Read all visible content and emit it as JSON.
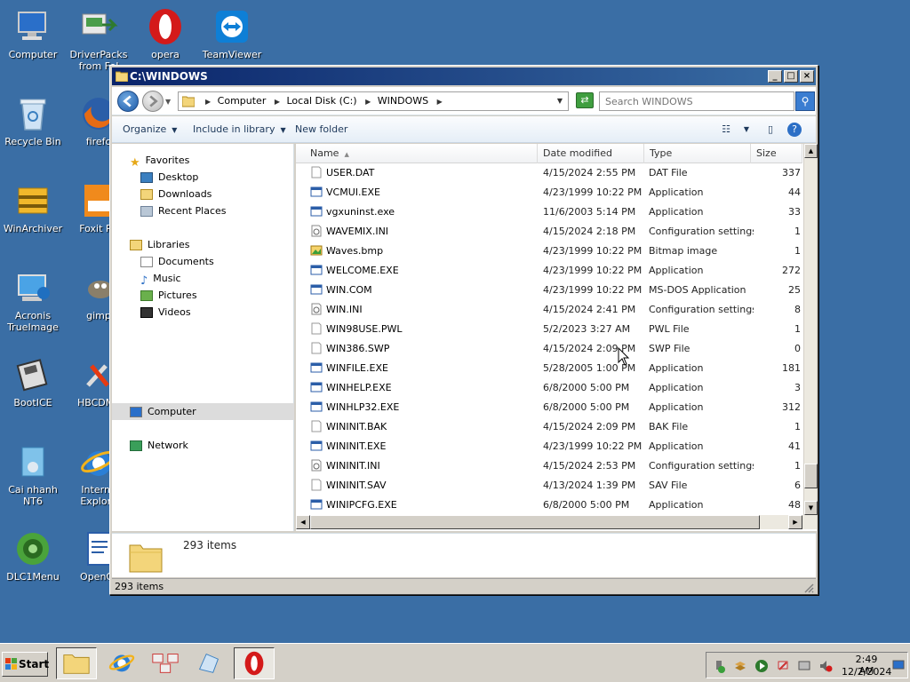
{
  "desktop": {
    "icons": [
      {
        "label": "Computer"
      },
      {
        "label": "DriverPacks from Fol"
      },
      {
        "label": "opera"
      },
      {
        "label": "TeamViewer"
      },
      {
        "label": "Recycle Bin"
      },
      {
        "label": "firefo"
      },
      {
        "label": "WinArchiver"
      },
      {
        "label": "Foxit Re"
      },
      {
        "label": "Acronis TrueImage"
      },
      {
        "label": "gimp"
      },
      {
        "label": "BootICE"
      },
      {
        "label": "HBCDMe"
      },
      {
        "label": "Cai nhanh NT6"
      },
      {
        "label": "Interne Explore"
      },
      {
        "label": "DLC1Menu"
      },
      {
        "label": "OpenOf"
      }
    ]
  },
  "window": {
    "title": "C:\\WINDOWS",
    "buttons": {
      "minimize": "_",
      "maximize": "□",
      "close": "×"
    },
    "address": {
      "crumbs": [
        "Computer",
        "Local Disk (C:)",
        "WINDOWS"
      ]
    },
    "search": {
      "placeholder": "Search WINDOWS"
    },
    "toolbar": {
      "organize": "Organize",
      "include": "Include in library",
      "new_folder": "New folder"
    },
    "nav": {
      "favorites": "Favorites",
      "desktop": "Desktop",
      "downloads": "Downloads",
      "recent": "Recent Places",
      "libraries": "Libraries",
      "documents": "Documents",
      "music": "Music",
      "pictures": "Pictures",
      "videos": "Videos",
      "computer": "Computer",
      "network": "Network"
    },
    "columns": {
      "name": "Name",
      "date": "Date modified",
      "type": "Type",
      "size": "Size"
    },
    "files": [
      {
        "name": "USER.DAT",
        "date": "4/15/2024 2:55 PM",
        "type": "DAT File",
        "size": "337"
      },
      {
        "name": "VCMUI.EXE",
        "date": "4/23/1999 10:22 PM",
        "type": "Application",
        "size": "44"
      },
      {
        "name": "vgxuninst.exe",
        "date": "11/6/2003 5:14 PM",
        "type": "Application",
        "size": "33"
      },
      {
        "name": "WAVEMIX.INI",
        "date": "4/15/2024 2:18 PM",
        "type": "Configuration settings",
        "size": "1"
      },
      {
        "name": "Waves.bmp",
        "date": "4/23/1999 10:22 PM",
        "type": "Bitmap image",
        "size": "1"
      },
      {
        "name": "WELCOME.EXE",
        "date": "4/23/1999 10:22 PM",
        "type": "Application",
        "size": "272"
      },
      {
        "name": "WIN.COM",
        "date": "4/23/1999 10:22 PM",
        "type": "MS-DOS Application",
        "size": "25"
      },
      {
        "name": "WIN.INI",
        "date": "4/15/2024 2:41 PM",
        "type": "Configuration settings",
        "size": "8"
      },
      {
        "name": "WIN98USE.PWL",
        "date": "5/2/2023 3:27 AM",
        "type": "PWL File",
        "size": "1"
      },
      {
        "name": "WIN386.SWP",
        "date": "4/15/2024 2:09 PM",
        "type": "SWP File",
        "size": "0"
      },
      {
        "name": "WINFILE.EXE",
        "date": "5/28/2005 1:00 PM",
        "type": "Application",
        "size": "181"
      },
      {
        "name": "WINHELP.EXE",
        "date": "6/8/2000 5:00 PM",
        "type": "Application",
        "size": "3"
      },
      {
        "name": "WINHLP32.EXE",
        "date": "6/8/2000 5:00 PM",
        "type": "Application",
        "size": "312"
      },
      {
        "name": "WININIT.BAK",
        "date": "4/15/2024 2:09 PM",
        "type": "BAK File",
        "size": "1"
      },
      {
        "name": "WININIT.EXE",
        "date": "4/23/1999 10:22 PM",
        "type": "Application",
        "size": "41"
      },
      {
        "name": "WININIT.INI",
        "date": "4/15/2024 2:53 PM",
        "type": "Configuration settings",
        "size": "1"
      },
      {
        "name": "WININIT.SAV",
        "date": "4/13/2024 1:39 PM",
        "type": "SAV File",
        "size": "6"
      },
      {
        "name": "WINIPCFG.EXE",
        "date": "6/8/2000 5:00 PM",
        "type": "Application",
        "size": "48"
      }
    ],
    "details": {
      "count": "293 items"
    },
    "status": "293 items"
  },
  "taskbar": {
    "start": "Start",
    "clock_time": "2:49 AM",
    "clock_date": "12/2/2024"
  }
}
